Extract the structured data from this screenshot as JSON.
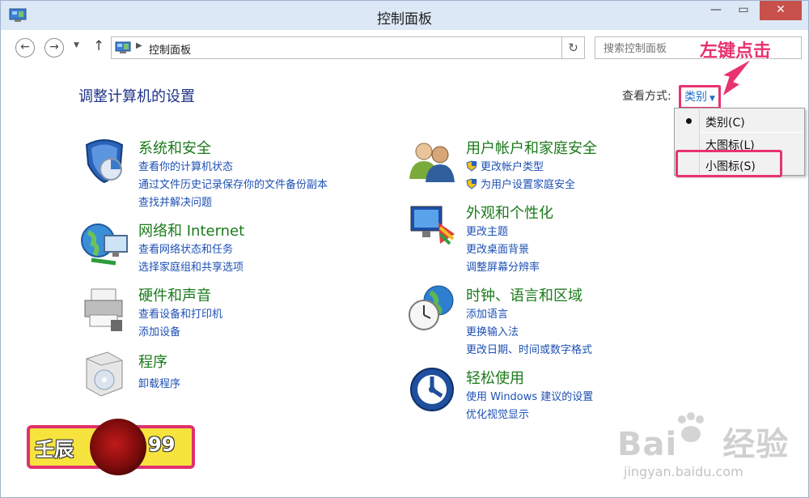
{
  "window": {
    "title": "控制面板"
  },
  "nav": {
    "address": "控制面板",
    "search_placeholder": "搜索控制面板"
  },
  "heading": "调整计算机的设置",
  "view": {
    "label": "查看方式:",
    "selected": "类别",
    "menu": [
      "类别(C)",
      "大图标(L)",
      "小图标(S)"
    ]
  },
  "annotation": "左键点击",
  "categories": {
    "system": {
      "title": "系统和安全",
      "links": [
        "查看你的计算机状态",
        "通过文件历史记录保存你的文件备份副本",
        "查找并解决问题"
      ]
    },
    "network": {
      "title": "网络和 Internet",
      "links": [
        "查看网络状态和任务",
        "选择家庭组和共享选项"
      ]
    },
    "hardware": {
      "title": "硬件和声音",
      "links": [
        "查看设备和打印机",
        "添加设备"
      ]
    },
    "programs": {
      "title": "程序",
      "links": [
        "卸载程序"
      ]
    },
    "accounts": {
      "title": "用户帐户和家庭安全",
      "links": [
        "更改帐户类型",
        "为用户设置家庭安全"
      ]
    },
    "appearance": {
      "title": "外观和个性化",
      "links": [
        "更改主题",
        "更改桌面背景",
        "调整屏幕分辨率"
      ]
    },
    "clock": {
      "title": "时钟、语言和区域",
      "links": [
        "添加语言",
        "更换输入法",
        "更改日期、时间或数字格式"
      ]
    },
    "ease": {
      "title": "轻松使用",
      "links": [
        "使用 Windows 建议的设置",
        "优化视觉显示"
      ]
    }
  },
  "watermark": {
    "badge_left": "壬辰",
    "badge_right": "99",
    "baidu": "Bai",
    "baidu_cn": "经验",
    "url": "jingyan.baidu.com"
  }
}
